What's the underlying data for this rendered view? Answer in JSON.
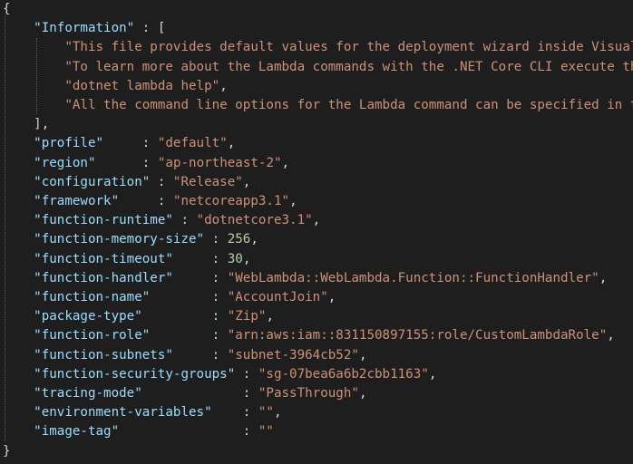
{
  "editor": {
    "theme_colors": {
      "background": "#1e1e1e",
      "key": "#9cdcfe",
      "string": "#ce9178",
      "number": "#b5cea8",
      "punctuation": "#d4d4d4"
    },
    "lines": [
      [
        {
          "t": "{",
          "c": "p"
        }
      ],
      [
        {
          "t": "    ",
          "c": "p"
        },
        {
          "t": "\"Information\"",
          "c": "k"
        },
        {
          "t": " : [",
          "c": "p"
        }
      ],
      [
        {
          "t": "        ",
          "c": "p"
        },
        {
          "t": "\"This file provides default values for the deployment wizard inside Visual Studio and the AWS Lambda commands added to the .NET Core CLI.\"",
          "c": "s"
        },
        {
          "t": ",",
          "c": "p"
        }
      ],
      [
        {
          "t": "        ",
          "c": "p"
        },
        {
          "t": "\"To learn more about the Lambda commands with the .NET Core CLI execute the following command at the command line in the project root directory.\"",
          "c": "s"
        },
        {
          "t": ",",
          "c": "p"
        }
      ],
      [
        {
          "t": "        ",
          "c": "p"
        },
        {
          "t": "\"dotnet lambda help\"",
          "c": "s"
        },
        {
          "t": ",",
          "c": "p"
        }
      ],
      [
        {
          "t": "        ",
          "c": "p"
        },
        {
          "t": "\"All the command line options for the Lambda command can be specified in this file.\"",
          "c": "s"
        }
      ],
      [
        {
          "t": "    ],",
          "c": "p"
        }
      ],
      [
        {
          "t": "    ",
          "c": "p"
        },
        {
          "t": "\"profile\"",
          "c": "k"
        },
        {
          "t": "     : ",
          "c": "p"
        },
        {
          "t": "\"default\"",
          "c": "s"
        },
        {
          "t": ",",
          "c": "p"
        }
      ],
      [
        {
          "t": "    ",
          "c": "p"
        },
        {
          "t": "\"region\"",
          "c": "k"
        },
        {
          "t": "      : ",
          "c": "p"
        },
        {
          "t": "\"ap-northeast-2\"",
          "c": "s"
        },
        {
          "t": ",",
          "c": "p"
        }
      ],
      [
        {
          "t": "    ",
          "c": "p"
        },
        {
          "t": "\"configuration\"",
          "c": "k"
        },
        {
          "t": " : ",
          "c": "p"
        },
        {
          "t": "\"Release\"",
          "c": "s"
        },
        {
          "t": ",",
          "c": "p"
        }
      ],
      [
        {
          "t": "    ",
          "c": "p"
        },
        {
          "t": "\"framework\"",
          "c": "k"
        },
        {
          "t": "     : ",
          "c": "p"
        },
        {
          "t": "\"netcoreapp3.1\"",
          "c": "s"
        },
        {
          "t": ",",
          "c": "p"
        }
      ],
      [
        {
          "t": "    ",
          "c": "p"
        },
        {
          "t": "\"function-runtime\"",
          "c": "k"
        },
        {
          "t": " : ",
          "c": "p"
        },
        {
          "t": "\"dotnetcore3.1\"",
          "c": "s"
        },
        {
          "t": ",",
          "c": "p"
        }
      ],
      [
        {
          "t": "    ",
          "c": "p"
        },
        {
          "t": "\"function-memory-size\"",
          "c": "k"
        },
        {
          "t": " : ",
          "c": "p"
        },
        {
          "t": "256",
          "c": "n"
        },
        {
          "t": ",",
          "c": "p"
        }
      ],
      [
        {
          "t": "    ",
          "c": "p"
        },
        {
          "t": "\"function-timeout\"",
          "c": "k"
        },
        {
          "t": "     : ",
          "c": "p"
        },
        {
          "t": "30",
          "c": "n"
        },
        {
          "t": ",",
          "c": "p"
        }
      ],
      [
        {
          "t": "    ",
          "c": "p"
        },
        {
          "t": "\"function-handler\"",
          "c": "k"
        },
        {
          "t": "     : ",
          "c": "p"
        },
        {
          "t": "\"WebLambda::WebLambda.Function::FunctionHandler\"",
          "c": "s"
        },
        {
          "t": ",",
          "c": "p"
        }
      ],
      [
        {
          "t": "    ",
          "c": "p"
        },
        {
          "t": "\"function-name\"",
          "c": "k"
        },
        {
          "t": "        : ",
          "c": "p"
        },
        {
          "t": "\"AccountJoin\"",
          "c": "s"
        },
        {
          "t": ",",
          "c": "p"
        }
      ],
      [
        {
          "t": "    ",
          "c": "p"
        },
        {
          "t": "\"package-type\"",
          "c": "k"
        },
        {
          "t": "         : ",
          "c": "p"
        },
        {
          "t": "\"Zip\"",
          "c": "s"
        },
        {
          "t": ",",
          "c": "p"
        }
      ],
      [
        {
          "t": "    ",
          "c": "p"
        },
        {
          "t": "\"function-role\"",
          "c": "k"
        },
        {
          "t": "        : ",
          "c": "p"
        },
        {
          "t": "\"arn:aws:iam::831150897155:role/CustomLambdaRole\"",
          "c": "s"
        },
        {
          "t": ",",
          "c": "p"
        }
      ],
      [
        {
          "t": "    ",
          "c": "p"
        },
        {
          "t": "\"function-subnets\"",
          "c": "k"
        },
        {
          "t": "     : ",
          "c": "p"
        },
        {
          "t": "\"subnet-3964cb52\"",
          "c": "s"
        },
        {
          "t": ",",
          "c": "p"
        }
      ],
      [
        {
          "t": "    ",
          "c": "p"
        },
        {
          "t": "\"function-security-groups\"",
          "c": "k"
        },
        {
          "t": " : ",
          "c": "p"
        },
        {
          "t": "\"sg-07bea6a6b2cbb1163\"",
          "c": "s"
        },
        {
          "t": ",",
          "c": "p"
        }
      ],
      [
        {
          "t": "    ",
          "c": "p"
        },
        {
          "t": "\"tracing-mode\"",
          "c": "k"
        },
        {
          "t": "             : ",
          "c": "p"
        },
        {
          "t": "\"PassThrough\"",
          "c": "s"
        },
        {
          "t": ",",
          "c": "p"
        }
      ],
      [
        {
          "t": "    ",
          "c": "p"
        },
        {
          "t": "\"environment-variables\"",
          "c": "k"
        },
        {
          "t": "    : ",
          "c": "p"
        },
        {
          "t": "\"\"",
          "c": "s"
        },
        {
          "t": ",",
          "c": "p"
        }
      ],
      [
        {
          "t": "    ",
          "c": "p"
        },
        {
          "t": "\"image-tag\"",
          "c": "k"
        },
        {
          "t": "                : ",
          "c": "p"
        },
        {
          "t": "\"\"",
          "c": "s"
        }
      ],
      [
        {
          "t": "}",
          "c": "p"
        }
      ]
    ]
  }
}
